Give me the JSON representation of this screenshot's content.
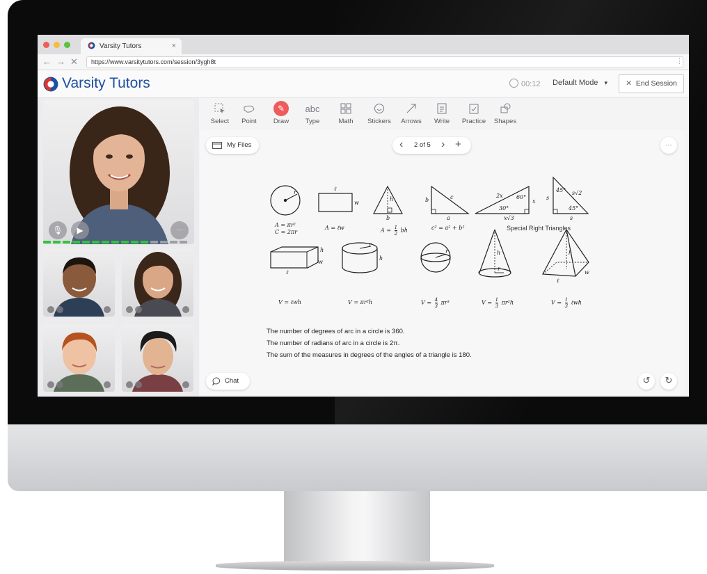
{
  "browser": {
    "tab_title": "Varsity Tutors",
    "tab_close": "×",
    "url": "https://www.varsitytutors.com/session/3ygh8t",
    "nav_back": "←",
    "nav_forward": "→",
    "nav_stop": "✕",
    "menu": "⋮",
    "traffic_lights": [
      "#ee5d56",
      "#f4bd3e",
      "#5bc341"
    ]
  },
  "header": {
    "brand": "Varsity Tutors",
    "timer": "00:12",
    "mode": "Default Mode",
    "mode_caret": "▾",
    "end_session": "End Session",
    "end_icon": "✕"
  },
  "colors": {
    "brand_blue": "#1e4fa3",
    "brand_red": "#e0352b",
    "draw_active": "#ef5b5b",
    "meter_on": "#35c23f",
    "meter_off": "#9aa0a6"
  },
  "video": {
    "main_participant": "tutor",
    "audio_meter_level": 0.7,
    "participants": [
      "student-1",
      "student-2",
      "student-3",
      "student-4"
    ],
    "more": "···"
  },
  "toolbar": {
    "active": "Draw",
    "tools": [
      {
        "label": "Select",
        "icon": "select-icon"
      },
      {
        "label": "Point",
        "icon": "point-icon"
      },
      {
        "label": "Draw",
        "icon": "pencil-icon"
      },
      {
        "label": "Type",
        "icon": "abc-icon"
      },
      {
        "label": "Math",
        "icon": "math-icon"
      },
      {
        "label": "Stickers",
        "icon": "smiley-icon"
      },
      {
        "label": "Arrows",
        "icon": "arrow-icon"
      },
      {
        "label": "Write",
        "icon": "write-icon"
      },
      {
        "label": "Practice",
        "icon": "practice-icon"
      },
      {
        "label": "Shapes",
        "icon": "shapes-icon"
      }
    ],
    "type_glyph": "abc"
  },
  "board": {
    "my_files": "My Files",
    "page_indicator": "2 of 5",
    "prev": "‹",
    "next": "›",
    "add": "+",
    "more": "···",
    "chat": "Chat",
    "undo": "↺",
    "redo": "↻",
    "formulas": {
      "circle_area": "A = πr²",
      "circle_circ": "C = 2πr",
      "rect_area": "A = ℓw",
      "tri_area_lhs": "A =",
      "tri_area_num": "1",
      "tri_area_den": "2",
      "tri_area_rhs": "bh",
      "pythag": "c² = a² + b²",
      "special": "Special Right Triangles",
      "box_vol": "V = ℓwh",
      "cyl_vol": "V = πr²h",
      "sphere_lhs": "V =",
      "sphere_num": "4",
      "sphere_den": "3",
      "sphere_rhs": "πr³",
      "cone_lhs": "V =",
      "cone_num": "1",
      "cone_den": "3",
      "cone_rhs": "πr²h",
      "pyr_lhs": "V =",
      "pyr_num": "1",
      "pyr_den": "3",
      "pyr_rhs": "ℓwh"
    },
    "labels": {
      "r": "r",
      "l": "ℓ",
      "w": "w",
      "h": "h",
      "b": "b",
      "a": "a",
      "c": "c",
      "two_x": "2x",
      "x": "x",
      "x_root3": "x√3",
      "deg30": "30°",
      "deg60": "60°",
      "deg45a": "45°",
      "deg45b": "45°",
      "s": "s",
      "s_root2": "s√2"
    },
    "facts": [
      "The number of degrees of arc in a circle is 360.",
      "The number of radians of arc in a circle is 2π.",
      "The sum of the measures in degrees of the angles of a triangle is 180."
    ]
  }
}
